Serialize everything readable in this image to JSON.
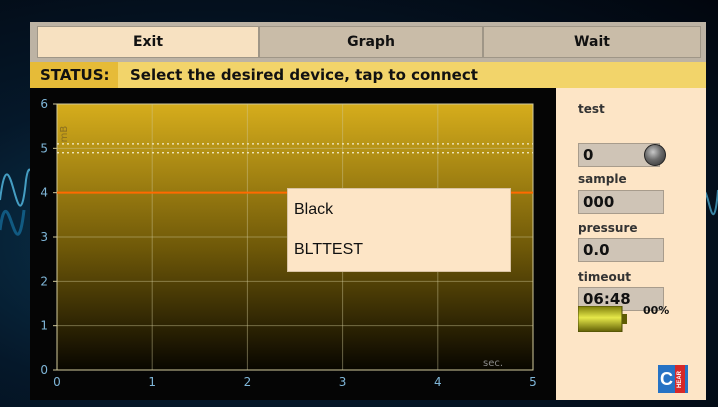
{
  "tabs": [
    {
      "label": "Exit",
      "state": "active"
    },
    {
      "label": "Graph",
      "state": "inactive"
    },
    {
      "label": "Wait",
      "state": "inactive"
    }
  ],
  "status": {
    "label": "STATUS:",
    "message": "Select the desired device, tap to connect"
  },
  "chart_data": {
    "type": "line",
    "title": "",
    "xlabel": "sec.",
    "ylabel": "mB",
    "xlim": [
      0,
      5
    ],
    "ylim": [
      0,
      6
    ],
    "x_ticks": [
      "0",
      "1",
      "2",
      "3",
      "4",
      "5"
    ],
    "y_ticks": [
      "0",
      "1",
      "2",
      "3",
      "4",
      "5",
      "6"
    ],
    "grid": true,
    "series": [
      {
        "values": [
          4,
          4
        ],
        "x": [
          0,
          5
        ],
        "color": "#ff6a00",
        "style": "solid"
      }
    ],
    "reference_lines": [
      {
        "y": 5.1,
        "style": "dotted",
        "color": "#f5f0d0"
      },
      {
        "y": 4.9,
        "style": "dotted",
        "color": "#f5f0d0"
      }
    ]
  },
  "side_panel": {
    "test": {
      "label": "test",
      "value": "0"
    },
    "sample": {
      "label": "sample",
      "value": "000"
    },
    "pressure": {
      "label": "pressure",
      "value": "0.0"
    },
    "timeout": {
      "label": "timeout",
      "value": "06:48"
    },
    "battery": {
      "level": 0,
      "text": "00%"
    }
  },
  "device_list": {
    "items": [
      "Black",
      "BLTTEST"
    ]
  },
  "logo": {
    "text": "C",
    "badge": "HEAR"
  },
  "colors": {
    "tab_active": "#f7e1c1",
    "tab_inactive": "#c9bca8",
    "status_bar": "#f2d46a",
    "status_label": "#e6bb38",
    "panel": "#fde5c6",
    "line": "#ff6a00"
  }
}
